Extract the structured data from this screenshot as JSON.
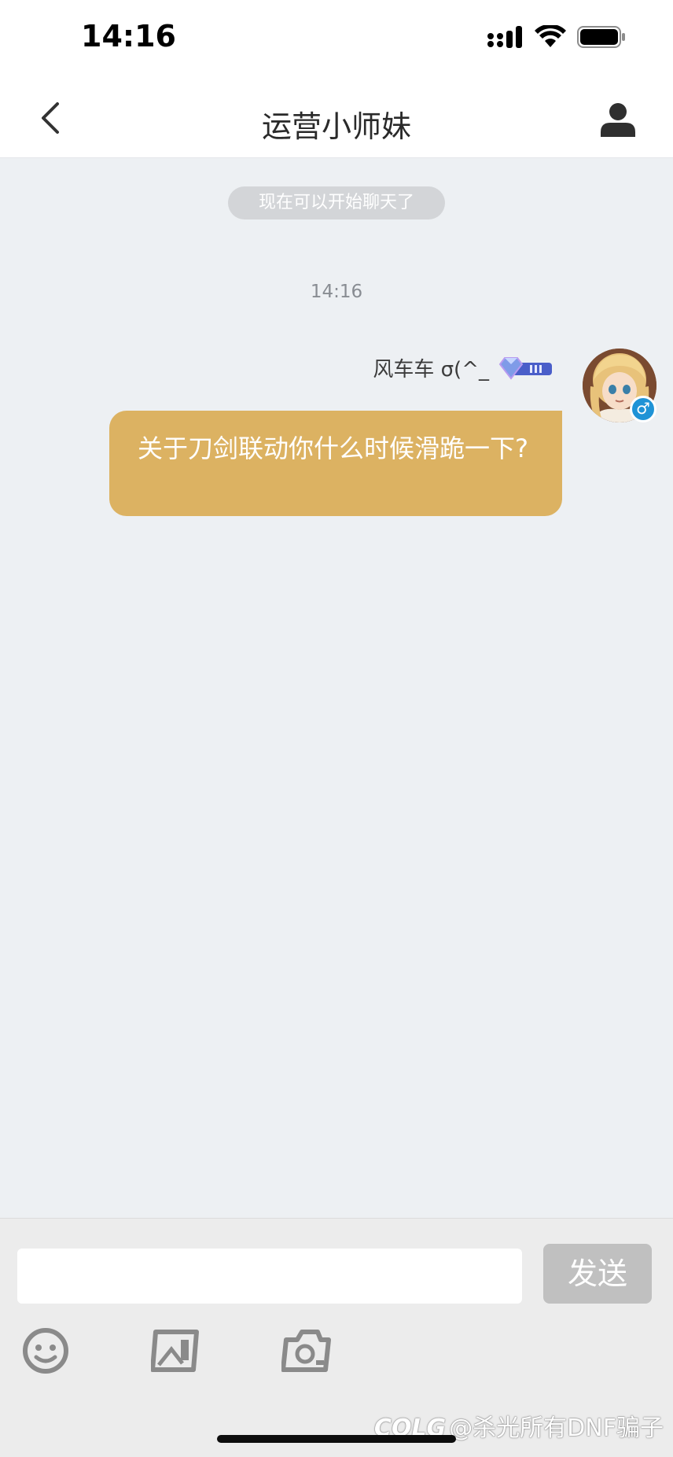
{
  "status_bar": {
    "time": "14:16"
  },
  "nav": {
    "title": "运营小师妹"
  },
  "chat": {
    "system_notice": "现在可以开始聊天了",
    "timestamp": "14:16",
    "messages": [
      {
        "sender_name": "风车车 σ(^_",
        "gender": "♂",
        "text": "关于刀剑联动你什么时候滑跪一下?",
        "bubble_color": "#dcb262"
      }
    ]
  },
  "composer": {
    "input_value": "",
    "send_label": "发送"
  },
  "watermark": {
    "logo": "COLG",
    "text": "@杀光所有DNF骗子"
  },
  "colors": {
    "chat_background": "#edf0f3",
    "send_button": "#c0c0c0",
    "gender_badge": "#1f93d6"
  }
}
